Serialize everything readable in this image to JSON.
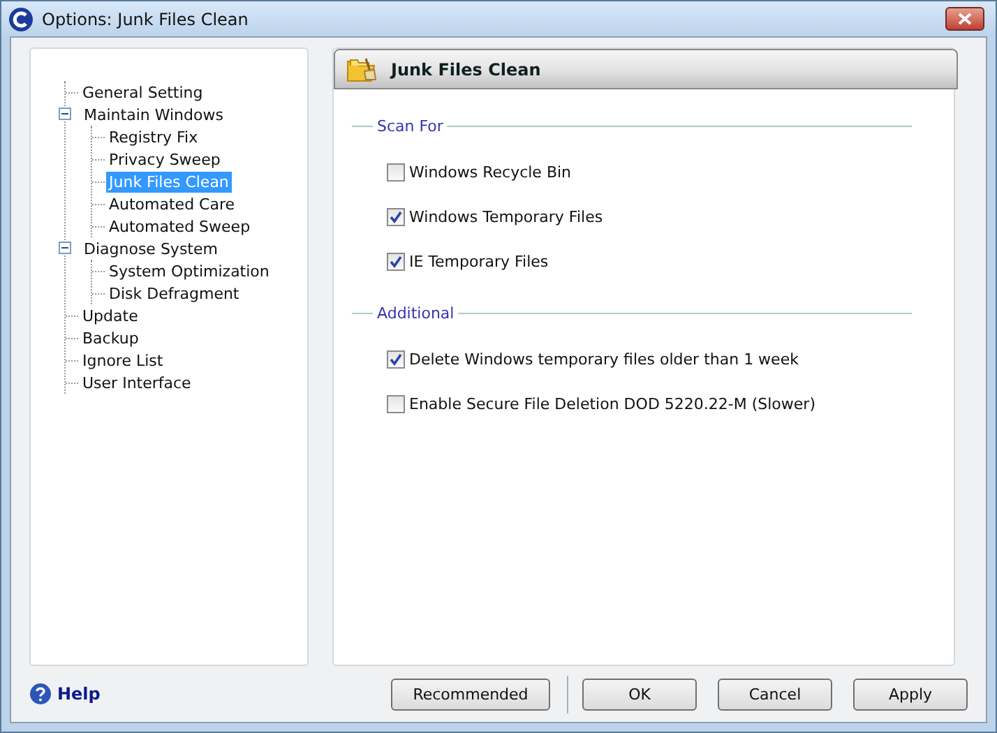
{
  "window": {
    "title": "Options: Junk Files Clean"
  },
  "tree": [
    {
      "label": "General Setting",
      "selected": false
    },
    {
      "label": "Maintain Windows",
      "selected": false,
      "expanded": true,
      "children": [
        {
          "label": "Registry Fix",
          "selected": false
        },
        {
          "label": "Privacy Sweep",
          "selected": false
        },
        {
          "label": "Junk Files Clean",
          "selected": true
        },
        {
          "label": "Automated Care",
          "selected": false
        },
        {
          "label": "Automated Sweep",
          "selected": false
        }
      ]
    },
    {
      "label": "Diagnose System",
      "selected": false,
      "expanded": true,
      "children": [
        {
          "label": "System Optimization",
          "selected": false
        },
        {
          "label": "Disk Defragment",
          "selected": false
        }
      ]
    },
    {
      "label": "Update",
      "selected": false
    },
    {
      "label": "Backup",
      "selected": false
    },
    {
      "label": "Ignore List",
      "selected": false
    },
    {
      "label": "User Interface",
      "selected": false
    }
  ],
  "panel": {
    "title": "Junk Files Clean",
    "groups": [
      {
        "title": "Scan For",
        "options": [
          {
            "label": "Windows Recycle Bin",
            "checked": false
          },
          {
            "label": "Windows Temporary Files",
            "checked": true
          },
          {
            "label": "IE Temporary Files",
            "checked": true
          }
        ]
      },
      {
        "title": "Additional",
        "options": [
          {
            "label": "Delete Windows temporary files older than 1 week",
            "checked": true
          },
          {
            "label": "Enable Secure File Deletion DOD 5220.22-M (Slower)",
            "checked": false
          }
        ]
      }
    ]
  },
  "help_link": "Help",
  "button_groups": [
    [
      "Recommended"
    ],
    [
      "OK",
      "Cancel",
      "Apply"
    ]
  ]
}
